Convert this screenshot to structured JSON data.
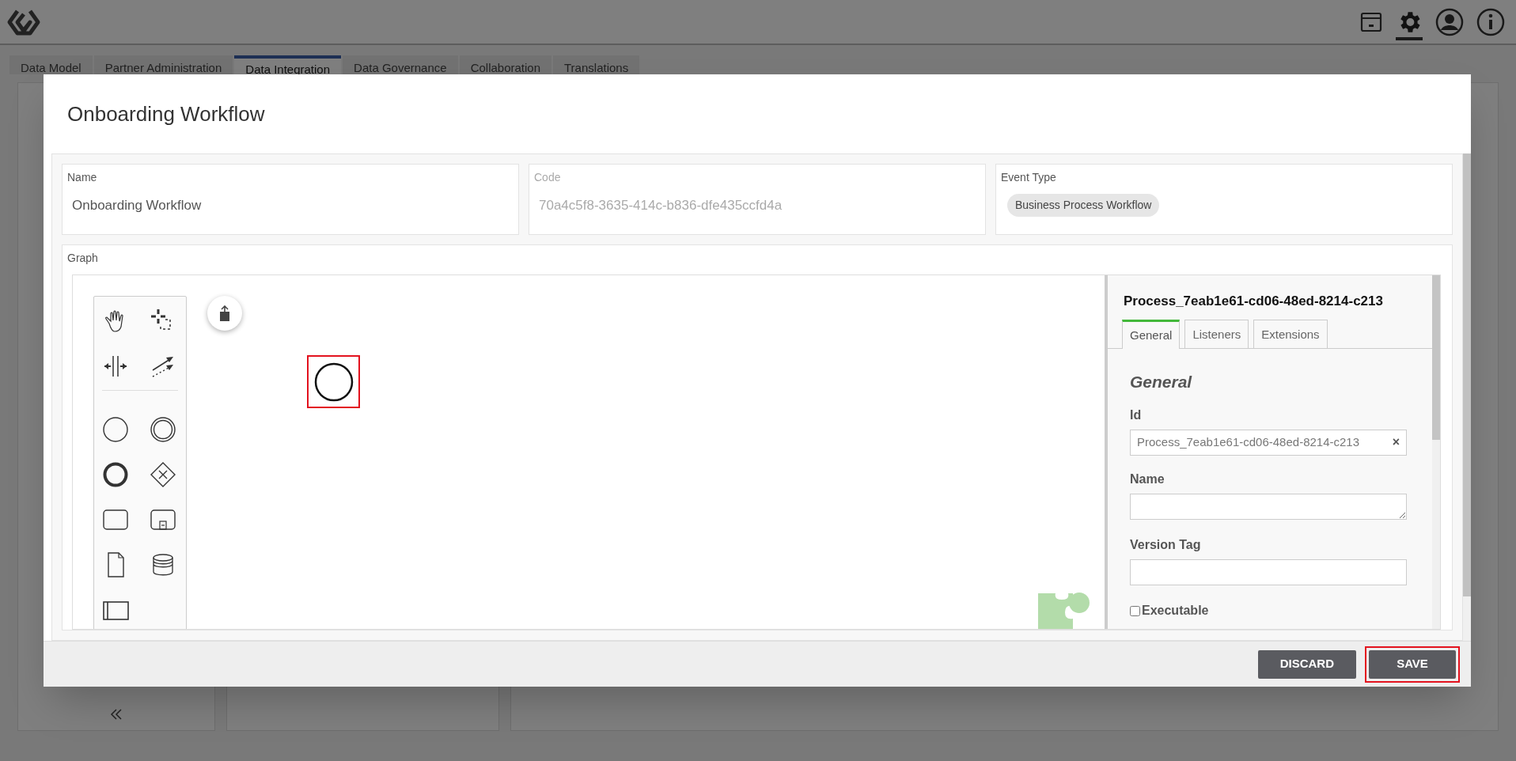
{
  "nav_tabs": [
    {
      "label": "Data Model",
      "selected": false
    },
    {
      "label": "Partner Administration",
      "selected": false
    },
    {
      "label": "Data Integration",
      "selected": true
    },
    {
      "label": "Data Governance",
      "selected": false
    },
    {
      "label": "Collaboration",
      "selected": false
    },
    {
      "label": "Translations",
      "selected": false
    }
  ],
  "dialog": {
    "title": "Onboarding Workflow",
    "fields": [
      {
        "label": "Name",
        "value": "Onboarding Workflow",
        "disabled": false
      },
      {
        "label": "Code",
        "value": "70a4c5f8-3635-414c-b836-dfe435ccfd4a",
        "disabled": true
      }
    ],
    "event_type": {
      "label": "Event Type",
      "chip": "Business Process Workflow"
    },
    "graph": {
      "label": "Graph",
      "start_event_highlighted": true,
      "properties": {
        "title": "Process_7eab1e61-cd06-48ed-8214-c213",
        "tabs": [
          {
            "label": "General",
            "selected": true
          },
          {
            "label": "Listeners",
            "selected": false
          },
          {
            "label": "Extensions",
            "selected": false
          }
        ],
        "section": "General",
        "id_label": "Id",
        "id_value": "Process_7eab1e61-cd06-48ed-8214-c213",
        "clear": "×",
        "name_label": "Name",
        "version_label": "Version Tag",
        "executable": {
          "label": "Executable",
          "checked": false
        }
      }
    },
    "buttons": [
      {
        "label": "DISCARD",
        "highlighted": false
      },
      {
        "label": "SAVE",
        "highlighted": true
      }
    ]
  }
}
